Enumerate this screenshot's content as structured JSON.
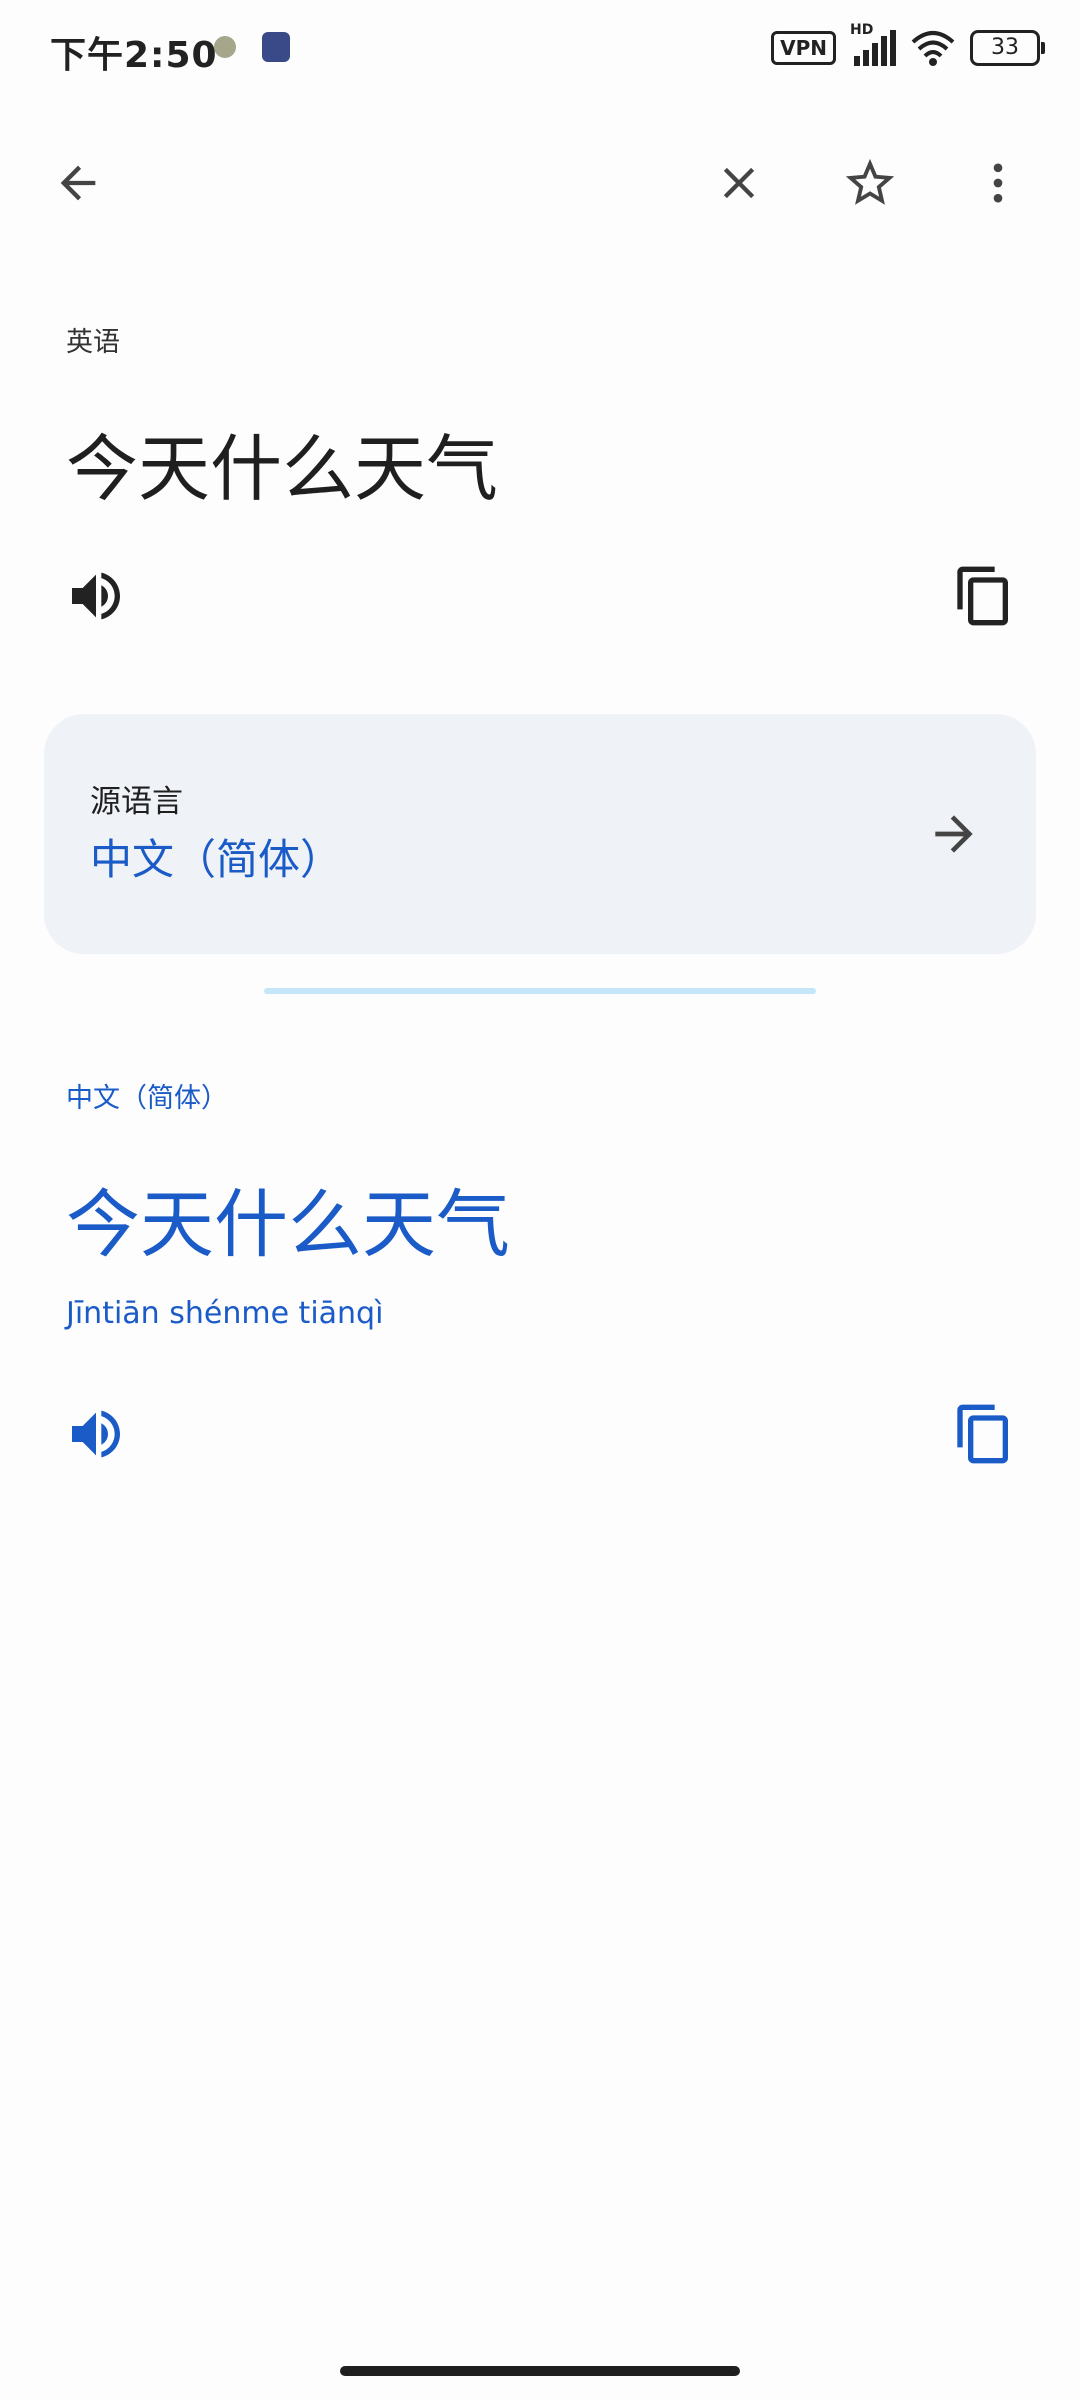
{
  "status_bar": {
    "time": "下午2:50",
    "vpn": "VPN",
    "signal_label": "HD",
    "battery": "33"
  },
  "toolbar": {
    "back_icon": "arrow-left-icon",
    "close_icon": "close-icon",
    "star_icon": "star-outline-icon",
    "more_icon": "more-vert-icon"
  },
  "source": {
    "language": "英语",
    "text": "今天什么天气",
    "speaker_icon": "volume-icon",
    "copy_icon": "copy-icon"
  },
  "source_language_card": {
    "title": "源语言",
    "value": "中文（简体）",
    "arrow_icon": "arrow-right-icon"
  },
  "target": {
    "language": "中文（简体）",
    "text": "今天什么天气",
    "romanization": "Jīntiān shénme tiānqì",
    "speaker_icon": "volume-icon",
    "copy_icon": "copy-icon"
  },
  "colors": {
    "accent": "#1a5bc7",
    "card_bg": "#eff2f7",
    "divider": "#c4e6f8",
    "text": "#1f1f1f"
  }
}
